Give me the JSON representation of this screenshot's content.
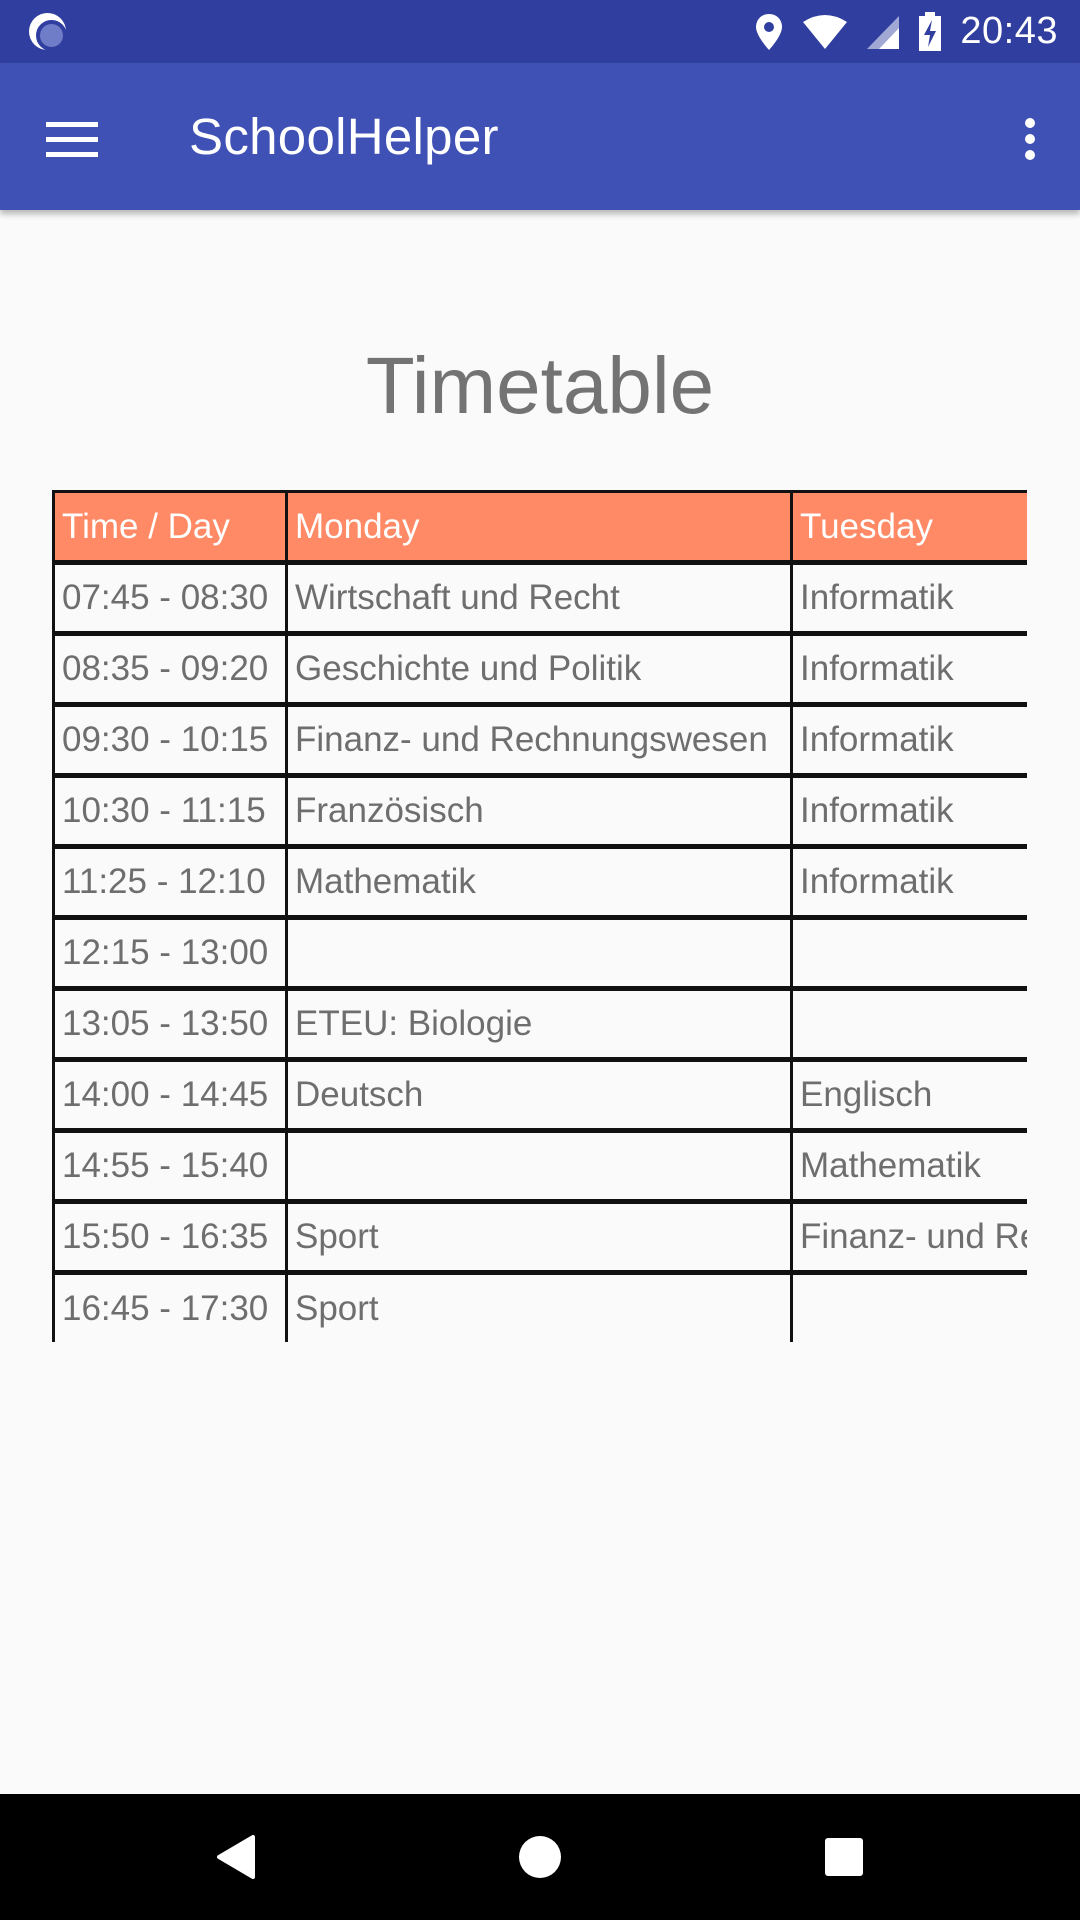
{
  "status_bar": {
    "time": "20:43",
    "icons": [
      "app-indicator-icon",
      "location-icon",
      "wifi-icon",
      "cell-signal-icon",
      "battery-charging-icon"
    ]
  },
  "app_bar": {
    "title": "SchoolHelper",
    "menu_icon": "hamburger-menu-icon",
    "overflow_icon": "more-vert-icon",
    "background": "#3f51b5"
  },
  "page": {
    "title": "Timetable"
  },
  "timetable": {
    "header_color": "#ff8a65",
    "headers": [
      "Time / Day",
      "Monday",
      "Tuesday"
    ],
    "rows": [
      {
        "time": "07:45 - 08:30",
        "monday": "Wirtschaft und Recht",
        "tuesday": "Informatik"
      },
      {
        "time": "08:35 - 09:20",
        "monday": "Geschichte und Politik",
        "tuesday": "Informatik"
      },
      {
        "time": "09:30 - 10:15",
        "monday": "Finanz- und Rechnungswesen",
        "tuesday": "Informatik"
      },
      {
        "time": "10:30 - 11:15",
        "monday": "Französisch",
        "tuesday": "Informatik"
      },
      {
        "time": "11:25 - 12:10",
        "monday": "Mathematik",
        "tuesday": "Informatik"
      },
      {
        "time": "12:15 - 13:00",
        "monday": "",
        "tuesday": ""
      },
      {
        "time": "13:05 - 13:50",
        "monday": "ETEU: Biologie",
        "tuesday": ""
      },
      {
        "time": "14:00 - 14:45",
        "monday": "Deutsch",
        "tuesday": "Englisch"
      },
      {
        "time": "14:55 - 15:40",
        "monday": "",
        "tuesday": "Mathematik"
      },
      {
        "time": "15:50 - 16:35",
        "monday": "Sport",
        "tuesday": "Finanz- und Re"
      },
      {
        "time": "16:45 - 17:30",
        "monday": "Sport",
        "tuesday": ""
      }
    ]
  },
  "nav_bar": {
    "icons": [
      "back-icon",
      "home-icon",
      "recents-icon"
    ]
  }
}
